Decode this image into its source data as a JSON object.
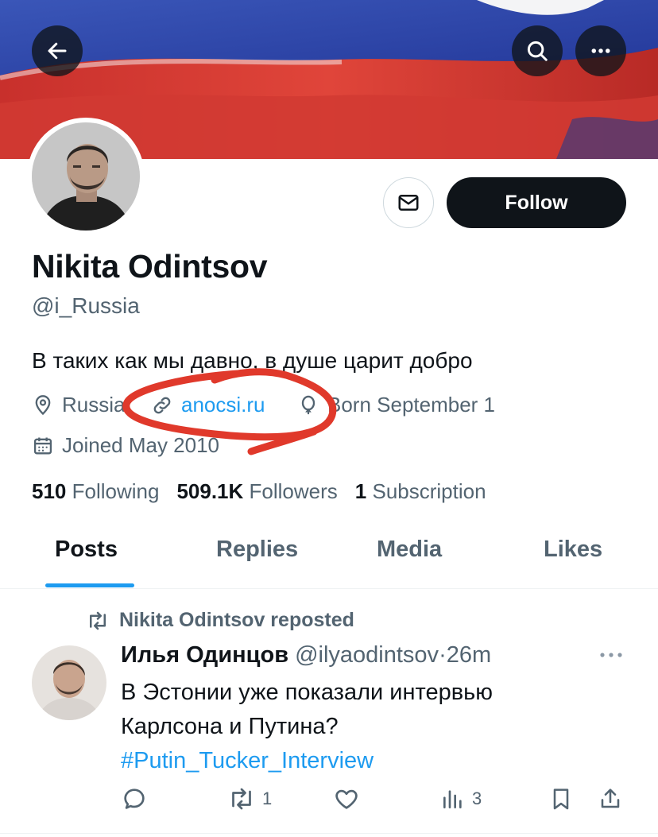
{
  "header": {
    "back_icon": "arrow-left-icon",
    "search_icon": "search-icon",
    "more_icon": "more-horizontal-icon"
  },
  "banner": {
    "colors": [
      "#ffffff",
      "#2f48a8",
      "#d63b34"
    ]
  },
  "profile": {
    "display_name": "Nikita Odintsov",
    "handle": "@i_Russia",
    "bio": "В таких как мы давно, в душе царит добро",
    "location": "Russia",
    "website": "anocsi.ru",
    "birthday": "Born September 1",
    "joined": "Joined May 2010",
    "follow_label": "Follow"
  },
  "stats": {
    "following_count": "510",
    "following_label": "Following",
    "followers_count": "509.1K",
    "followers_label": "Followers",
    "subscriptions_count": "1",
    "subscriptions_label": "Subscription"
  },
  "tabs": [
    {
      "label": "Posts",
      "active": true
    },
    {
      "label": "Replies",
      "active": false
    },
    {
      "label": "Media",
      "active": false
    },
    {
      "label": "Likes",
      "active": false
    }
  ],
  "post": {
    "repost_text": "Nikita Odintsov reposted",
    "author_name": "Илья Одинцов",
    "author_handle": "@ilyaodintsov",
    "separator": "·",
    "time": "26m",
    "text_line1": "В Эстонии уже показали интервью",
    "text_line2": "Карлсона и Путина?",
    "hashtag": "#Putin_Tucker_Interview",
    "retweet_count": "1",
    "views_count": "3"
  },
  "accent_colors": {
    "link": "#1d9bf0",
    "annotation": "#e0392b",
    "button": "#0f1419"
  }
}
